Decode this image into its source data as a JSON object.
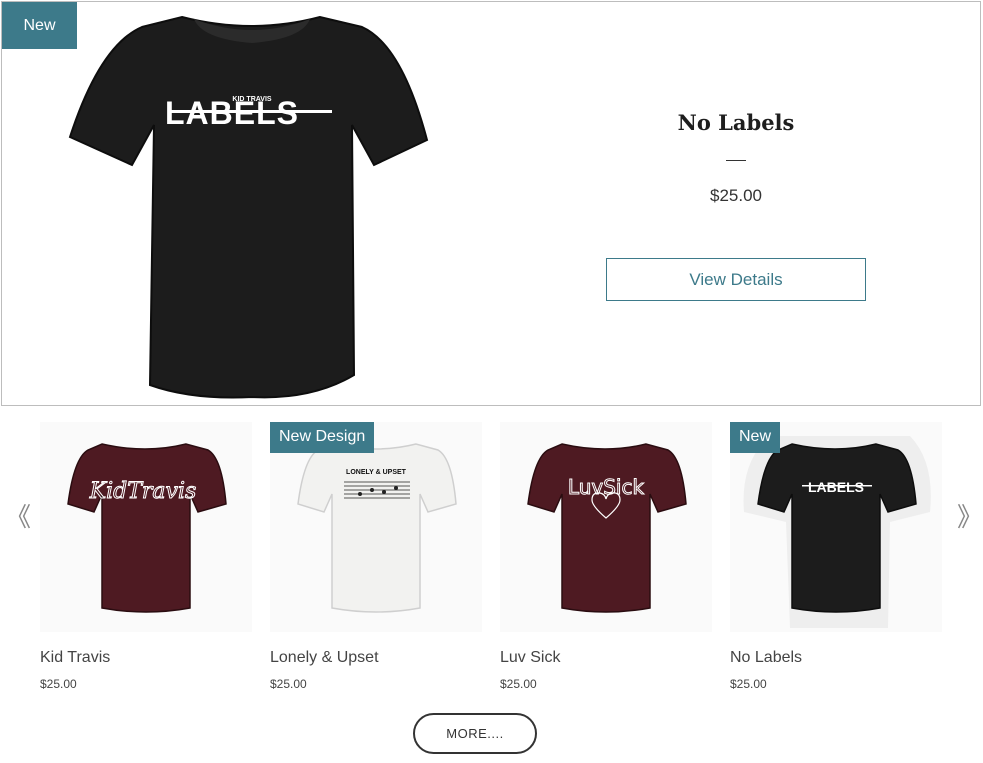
{
  "featured": {
    "ribbon": "New",
    "title": "No Labels",
    "price": "$25.00",
    "button": "View Details",
    "shirt_color": "#1c1c1c",
    "print": {
      "small": "KID TRAVIS",
      "big": "LABELS"
    }
  },
  "gallery": {
    "prev_arrow": "《",
    "next_arrow": "》",
    "items": [
      {
        "name": "Kid Travis",
        "price": "$25.00",
        "ribbon": "",
        "shirt_color": "#4e1a22",
        "print": "KidTravis"
      },
      {
        "name": "Lonely & Upset",
        "price": "$25.00",
        "ribbon": "New Design",
        "shirt_color": "#f2f2f0",
        "print": "LONELY & UPSET"
      },
      {
        "name": "Luv Sick",
        "price": "$25.00",
        "ribbon": "",
        "shirt_color": "#4e1a22",
        "print": "LuvSick"
      },
      {
        "name": "No Labels",
        "price": "$25.00",
        "ribbon": "New",
        "shirt_color": "#1c1c1c",
        "print": "LABELS"
      }
    ]
  },
  "more_button": "MORE...."
}
